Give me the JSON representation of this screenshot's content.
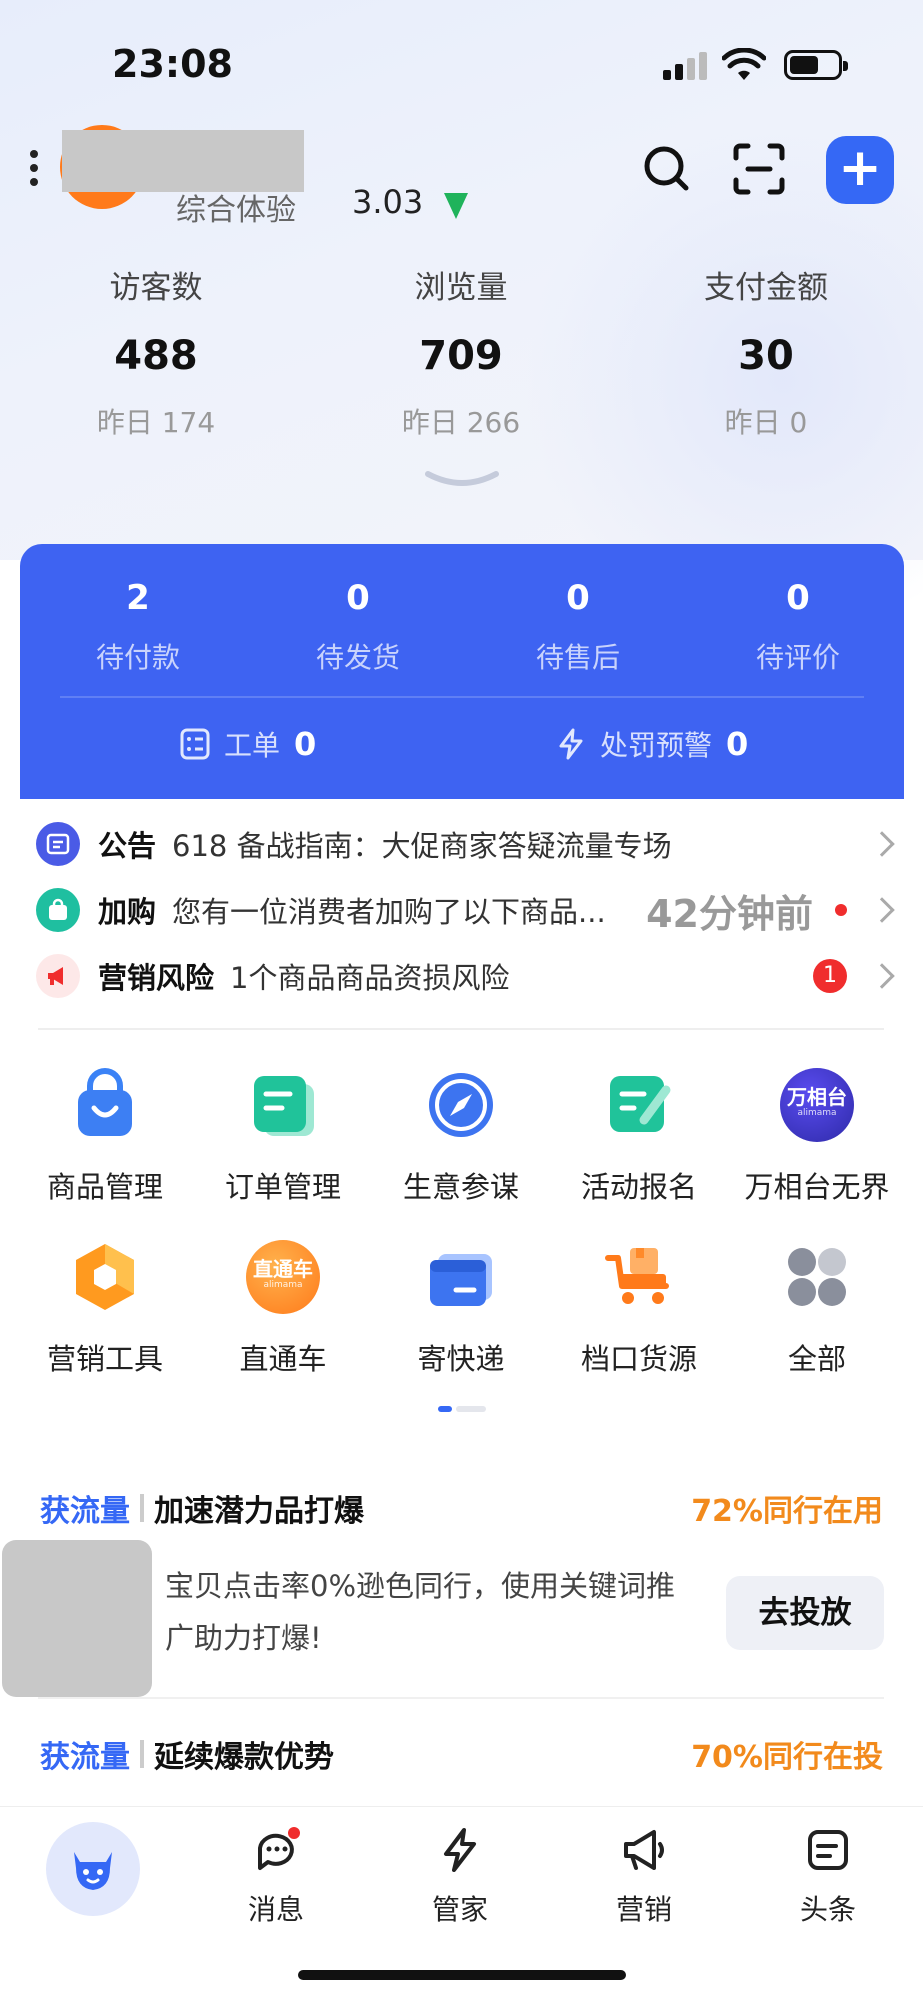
{
  "status_bar": {
    "time": "23:08"
  },
  "header": {
    "experience_label": "综合体验",
    "experience_score": "3.03",
    "trend_color": "#1fb35b",
    "add_button_label": "+",
    "accent_color": "#3568f5"
  },
  "stats": [
    {
      "label": "访客数",
      "value": "488",
      "prev": "昨日 174"
    },
    {
      "label": "浏览量",
      "value": "709",
      "prev": "昨日 266"
    },
    {
      "label": "支付金额",
      "value": "30",
      "prev": "昨日 0"
    }
  ],
  "orders": {
    "card_color": "#3e63f2",
    "items": [
      {
        "count": "2",
        "label": "待付款"
      },
      {
        "count": "0",
        "label": "待发货"
      },
      {
        "count": "0",
        "label": "待售后"
      },
      {
        "count": "0",
        "label": "待评价"
      }
    ],
    "work_order_label": "工单",
    "work_order_count": "0",
    "penalty_label": "处罚预警",
    "penalty_count": "0"
  },
  "notices": [
    {
      "title": "公告",
      "text": "618 备战指南：大促商家答疑流量专场",
      "time": "",
      "icon": "announcement-icon"
    },
    {
      "title": "加购",
      "text": "您有一位消费者加购了以下商品...",
      "time": "42分钟前",
      "icon": "shopping-bag-icon"
    },
    {
      "title": "营销风险",
      "text": "1个商品商品资损风险",
      "badge": "1",
      "icon": "megaphone-icon"
    }
  ],
  "grid": [
    {
      "label": "商品管理",
      "icon": "bag-icon"
    },
    {
      "label": "订单管理",
      "icon": "document-icon"
    },
    {
      "label": "生意参谋",
      "icon": "compass-icon"
    },
    {
      "label": "活动报名",
      "icon": "edit-form-icon"
    },
    {
      "label": "万相台无界",
      "icon": "wanxiangtai-logo",
      "logo_text": "万相台",
      "logo_sub": "alimama"
    },
    {
      "label": "营销工具",
      "icon": "hexagon-icon"
    },
    {
      "label": "直通车",
      "icon": "ztc-logo",
      "logo_text": "直通车",
      "logo_sub": "alimama"
    },
    {
      "label": "寄快递",
      "icon": "package-card-icon"
    },
    {
      "label": "档口货源",
      "icon": "cart-icon"
    },
    {
      "label": "全部",
      "icon": "all-apps-icon"
    }
  ],
  "flow": [
    {
      "tag": "获流量",
      "title": "加速潜力品打爆",
      "percent": "72%同行在用"
    },
    {
      "tag": "获流量",
      "title": "延续爆款优势",
      "percent": "70%同行在投"
    }
  ],
  "flow_card": {
    "description": "宝贝点击率0%逊色同行，使用关键词推广助力打爆!",
    "button": "去投放"
  },
  "tabbar": [
    {
      "label": "消息",
      "icon": "message-icon"
    },
    {
      "label": "管家",
      "icon": "lightning-icon"
    },
    {
      "label": "营销",
      "icon": "megaphone-icon"
    },
    {
      "label": "头条",
      "icon": "news-icon"
    }
  ]
}
